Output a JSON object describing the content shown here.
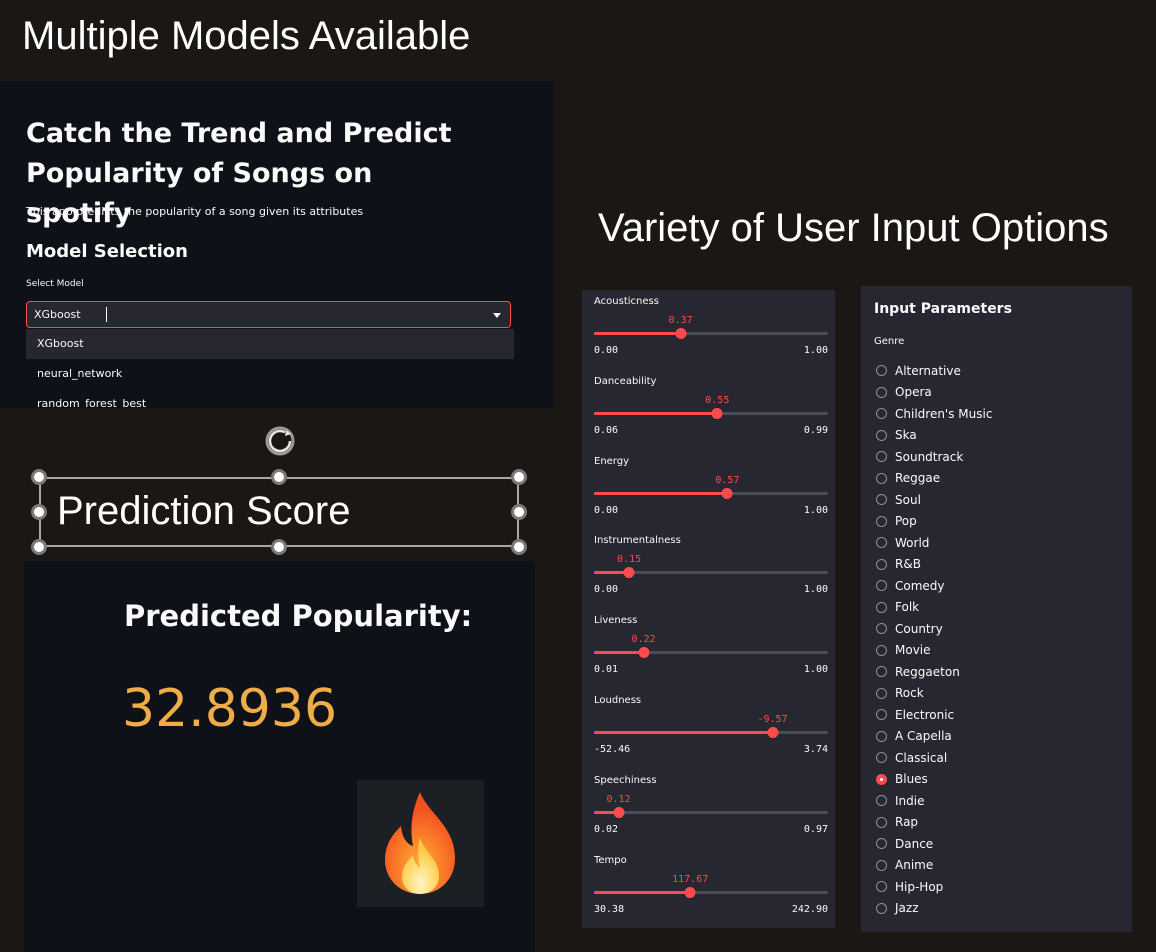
{
  "captions": {
    "top_left": "Multiple Models Available",
    "right": "Variety of User Input Options",
    "prediction": "Prediction Score"
  },
  "app": {
    "title": "Catch the Trend and Predict Popularity of Songs on spotify",
    "subtitle": "This app predicts the popularity of a song given its attributes",
    "model_section": "Model Selection",
    "select_label": "Select Model",
    "selected_model": "XGboost",
    "model_options": [
      "XGboost",
      "neural_network",
      "random_forest_best"
    ]
  },
  "prediction": {
    "heading": "Predicted Popularity:",
    "value": "32.8936",
    "icon": "fire-emoji"
  },
  "sliders": [
    {
      "label": "Acousticness",
      "value": "0.37",
      "min": "0.00",
      "max": "1.00",
      "fraction": 0.37
    },
    {
      "label": "Danceability",
      "value": "0.55",
      "min": "0.06",
      "max": "0.99",
      "fraction": 0.527
    },
    {
      "label": "Energy",
      "value": "0.57",
      "min": "0.00",
      "max": "1.00",
      "fraction": 0.57
    },
    {
      "label": "Instrumentalness",
      "value": "0.15",
      "min": "0.00",
      "max": "1.00",
      "fraction": 0.15
    },
    {
      "label": "Liveness",
      "value": "0.22",
      "min": "0.01",
      "max": "1.00",
      "fraction": 0.212
    },
    {
      "label": "Loudness",
      "value": "-9.57",
      "min": "-52.46",
      "max": "3.74",
      "fraction": 0.763
    },
    {
      "label": "Speechiness",
      "value": "0.12",
      "min": "0.02",
      "max": "0.97",
      "fraction": 0.105
    },
    {
      "label": "Tempo",
      "value": "117.67",
      "min": "30.38",
      "max": "242.90",
      "fraction": 0.411
    }
  ],
  "params": {
    "heading": "Input Parameters",
    "genre_label": "Genre",
    "selected": "Blues",
    "genres": [
      "Alternative",
      "Opera",
      "Children's Music",
      "Ska",
      "Soundtrack",
      "Reggae",
      "Soul",
      "Pop",
      "World",
      "R&B",
      "Comedy",
      "Folk",
      "Country",
      "Movie",
      "Reggaeton",
      "Rock",
      "Electronic",
      "A Capella",
      "Classical",
      "Blues",
      "Indie",
      "Rap",
      "Dance",
      "Anime",
      "Hip-Hop",
      "Jazz"
    ]
  },
  "colors": {
    "accent": "#ff4b4b",
    "prediction_value": "#f0ac47",
    "panel_dark": "#0e1117",
    "panel_widget": "#262730"
  }
}
